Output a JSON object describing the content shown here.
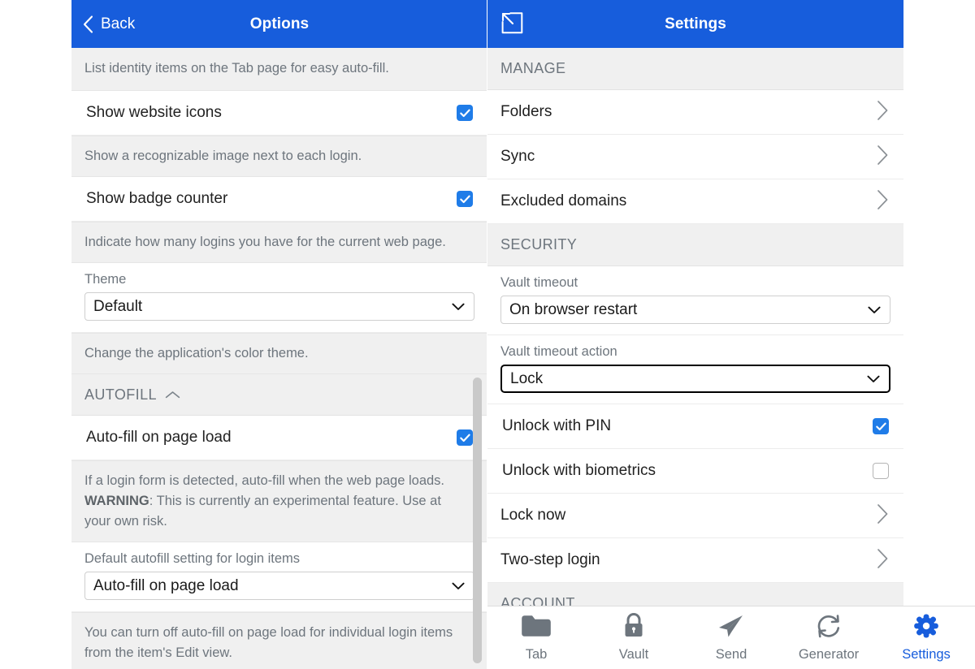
{
  "left_panel": {
    "header": {
      "back_label": "Back",
      "title": "Options",
      "back_icon": "chevron-left-icon"
    },
    "blocks": [
      {
        "kind": "help",
        "text": "List identity items on the Tab page for easy auto-fill."
      },
      {
        "kind": "toggle",
        "label": "Show website icons",
        "checked": true
      },
      {
        "kind": "help",
        "text": "Show a recognizable image next to each login."
      },
      {
        "kind": "toggle",
        "label": "Show badge counter",
        "checked": true
      },
      {
        "kind": "help",
        "text": "Indicate how many logins you have for the current web page."
      },
      {
        "kind": "select",
        "label": "Theme",
        "value": "Default",
        "focused": false
      },
      {
        "kind": "help",
        "text": "Change the application's color theme."
      },
      {
        "kind": "section",
        "label": "AUTOFILL",
        "icon": "chevron-up-icon"
      },
      {
        "kind": "toggle",
        "label": "Auto-fill on page load",
        "checked": true
      },
      {
        "kind": "help_warning",
        "pre": "If a login form is detected, auto-fill when the web page loads. ",
        "strong": "WARNING",
        "post": ": This is currently an experimental feature. Use at your own risk."
      },
      {
        "kind": "select",
        "label": "Default autofill setting for login items",
        "value": "Auto-fill on page load",
        "focused": false
      },
      {
        "kind": "help",
        "text": "You can turn off auto-fill on page load for individual login items from the item's Edit view."
      }
    ]
  },
  "right_panel": {
    "header": {
      "title": "Settings",
      "popout_icon": "pop-out-icon"
    },
    "blocks": [
      {
        "kind": "section",
        "label": "MANAGE"
      },
      {
        "kind": "nav",
        "label": "Folders",
        "icon": "chevron-right-icon"
      },
      {
        "kind": "nav",
        "label": "Sync",
        "icon": "chevron-right-icon"
      },
      {
        "kind": "nav",
        "label": "Excluded domains",
        "icon": "chevron-right-icon"
      },
      {
        "kind": "section",
        "label": "SECURITY"
      },
      {
        "kind": "select",
        "label": "Vault timeout",
        "value": "On browser restart",
        "focused": false
      },
      {
        "kind": "select",
        "label": "Vault timeout action",
        "value": "Lock",
        "focused": true
      },
      {
        "kind": "toggle",
        "label": "Unlock with PIN",
        "checked": true
      },
      {
        "kind": "toggle",
        "label": "Unlock with biometrics",
        "checked": false
      },
      {
        "kind": "nav",
        "label": "Lock now",
        "icon": "chevron-right-icon"
      },
      {
        "kind": "nav",
        "label": "Two-step login",
        "icon": "chevron-right-icon"
      },
      {
        "kind": "section",
        "label": "ACCOUNT"
      }
    ]
  },
  "bottom_nav": {
    "items": [
      {
        "label": "Tab",
        "icon": "folder-icon",
        "active": false
      },
      {
        "label": "Vault",
        "icon": "lock-icon",
        "active": false
      },
      {
        "label": "Send",
        "icon": "paper-plane-icon",
        "active": false
      },
      {
        "label": "Generator",
        "icon": "refresh-circle-icon",
        "active": false
      },
      {
        "label": "Settings",
        "icon": "gear-icon",
        "active": true
      }
    ]
  },
  "colors": {
    "brand_blue": "#175ddc",
    "checkbox_blue": "#1f7ce8",
    "muted_text": "#6d757d",
    "band_grey": "#f0f0f0",
    "scrollbar": "#c9c9c9"
  }
}
